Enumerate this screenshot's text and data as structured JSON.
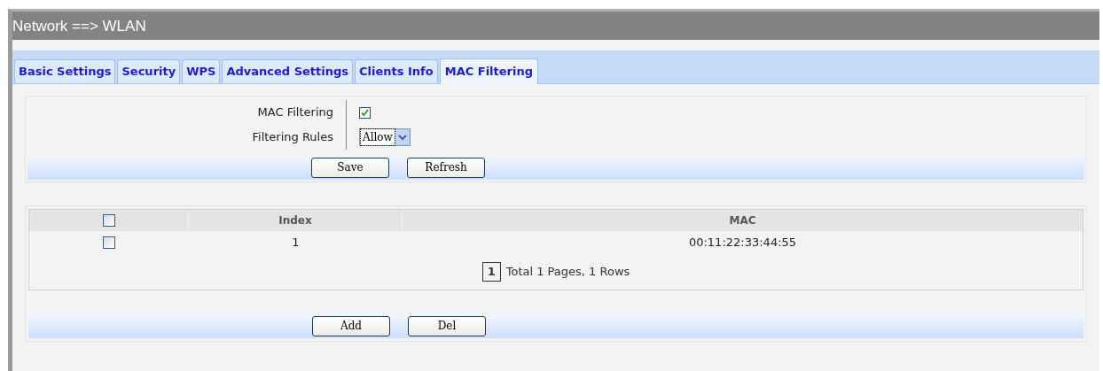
{
  "title": "Network ==> WLAN",
  "tabs": [
    {
      "label": "Basic Settings",
      "selected": false
    },
    {
      "label": "Security",
      "selected": false
    },
    {
      "label": "WPS",
      "selected": false
    },
    {
      "label": "Advanced Settings",
      "selected": false
    },
    {
      "label": "Clients Info",
      "selected": false
    },
    {
      "label": "MAC Filtering",
      "selected": true
    }
  ],
  "settings": {
    "mac_filtering": {
      "label": "MAC Filtering",
      "checked": true
    },
    "filtering_rules": {
      "label": "Filtering Rules",
      "value": "Allow"
    }
  },
  "settings_buttons": [
    "Save",
    "Refresh"
  ],
  "table": {
    "header_checked": false,
    "columns": [
      "Index",
      "MAC"
    ],
    "rows": [
      {
        "checked": false,
        "index": "1",
        "mac": "00:11:22:33:44:55"
      }
    ]
  },
  "pager": {
    "page": "1",
    "summary": "Total 1 Pages, 1 Rows"
  },
  "table_buttons": [
    "Add",
    "Del"
  ]
}
